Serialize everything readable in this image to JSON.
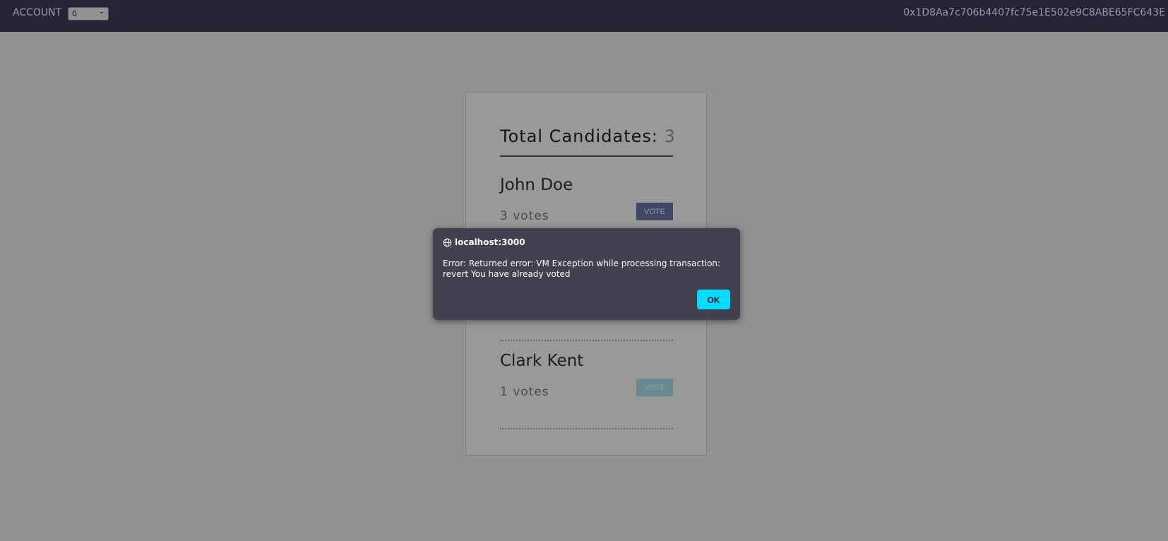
{
  "topbar": {
    "account_label": "ACCOUNT",
    "account_value": "0",
    "address": "0x1D8Aa7c706b4407fc75e1E502e9C8ABE65FC643E"
  },
  "card": {
    "title_label": "Total Candidates:",
    "total": "3",
    "candidates": [
      {
        "name": "John Doe",
        "votes": "3 votes",
        "vote_label": "VOTE",
        "vote_enabled": true
      },
      {
        "name": "",
        "votes": "",
        "vote_label": "",
        "vote_enabled": true
      },
      {
        "name": "Clark Kent",
        "votes": "1 votes",
        "vote_label": "VOTE",
        "vote_enabled": false
      }
    ]
  },
  "dialog": {
    "origin": "localhost:3000",
    "message": "Error: Returned error: VM Exception while processing transaction: revert You have already voted",
    "ok_label": "OK"
  },
  "colors": {
    "topbar": "#3b3f5c",
    "vote_button": "#6b77a8",
    "vote_button_disabled": "#aee6f5",
    "dialog_bg": "#42414d",
    "ok_button": "#00ddff"
  },
  "icons": {
    "dialog_origin": "globe-icon",
    "account_select": "chevron-down-icon"
  }
}
